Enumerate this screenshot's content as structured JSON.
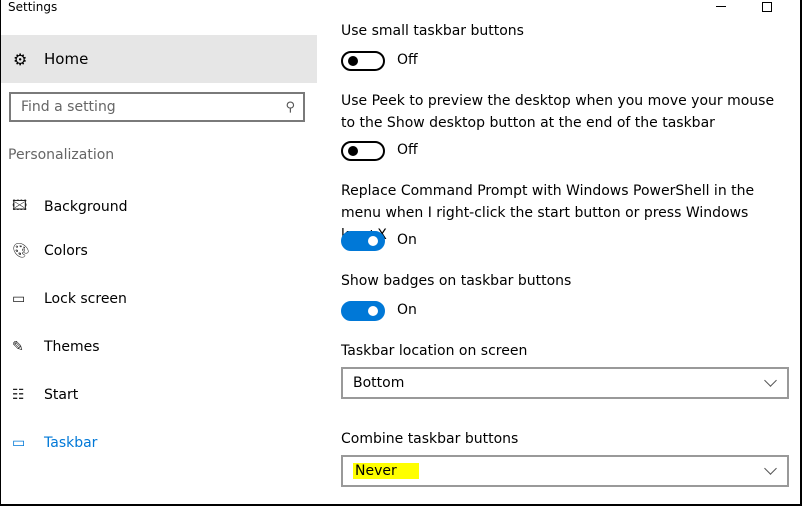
{
  "window": {
    "title": "Settings"
  },
  "sidebar": {
    "home": {
      "label": "Home",
      "icon": "gear-icon"
    },
    "search": {
      "placeholder": "Find a setting",
      "icon": "search-icon"
    },
    "section": "Personalization",
    "items": [
      {
        "label": "Background",
        "icon": "picture-icon"
      },
      {
        "label": "Colors",
        "icon": "palette-icon"
      },
      {
        "label": "Lock screen",
        "icon": "lock-screen-icon"
      },
      {
        "label": "Themes",
        "icon": "themes-icon"
      },
      {
        "label": "Start",
        "icon": "start-icon"
      },
      {
        "label": "Taskbar",
        "icon": "taskbar-icon",
        "active": true
      }
    ]
  },
  "main": {
    "settings": [
      {
        "label": "Use small taskbar buttons",
        "state": "Off"
      },
      {
        "label": "Use Peek to preview the desktop when you move your mouse to the Show desktop button at the end of the taskbar",
        "state": "Off"
      },
      {
        "label": "Replace Command Prompt with Windows PowerShell in the menu when I right-click the start button or press Windows key+X",
        "state": "On"
      },
      {
        "label": "Show badges on taskbar buttons",
        "state": "On"
      }
    ],
    "location": {
      "label": "Taskbar location on screen",
      "value": "Bottom"
    },
    "combine": {
      "label": "Combine taskbar buttons",
      "value": "Never",
      "highlight": "#ffff00"
    }
  },
  "colors": {
    "accent": "#0078d7"
  }
}
